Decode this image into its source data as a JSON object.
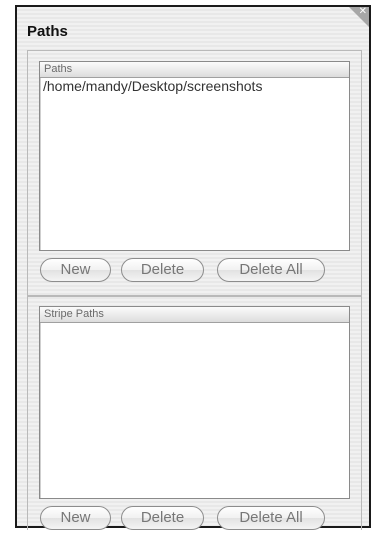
{
  "panel": {
    "title": "Paths"
  },
  "paths": {
    "header": "Paths",
    "items": [
      "/home/mandy/Desktop/screenshots"
    ],
    "buttons": {
      "new": "New",
      "delete": "Delete",
      "delete_all": "Delete All"
    }
  },
  "stripe_paths": {
    "header": "Stripe Paths",
    "items": [],
    "buttons": {
      "new": "New",
      "delete": "Delete",
      "delete_all": "Delete All"
    }
  },
  "icons": {
    "close": "close-icon"
  }
}
